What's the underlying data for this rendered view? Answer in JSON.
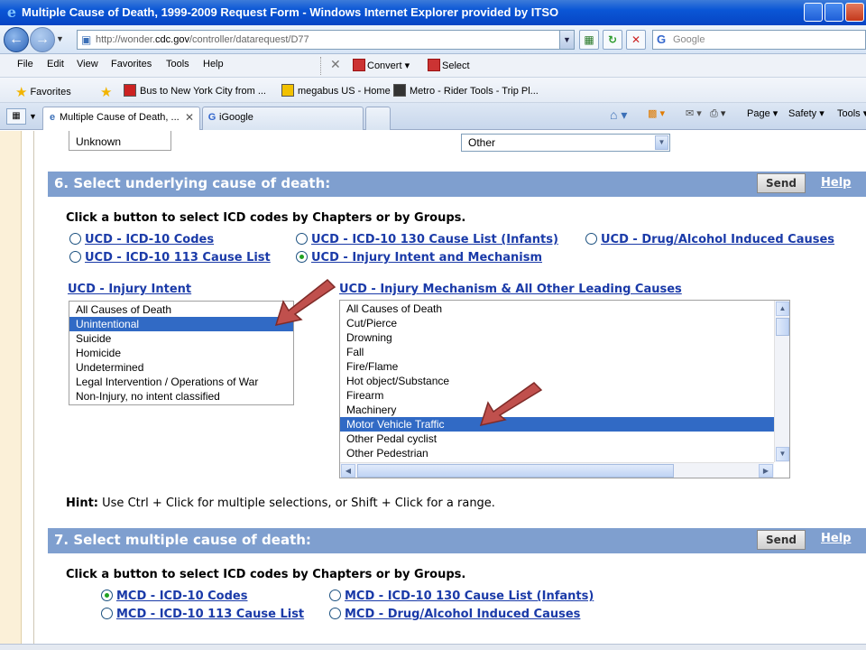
{
  "window": {
    "title": "Multiple Cause of Death, 1999-2009 Request Form - Windows Internet Explorer provided by ITSO"
  },
  "address": {
    "url_prefix": "http://wonder.",
    "url_domain": "cdc.gov",
    "url_path": "/controller/datarequest/D77",
    "search_placeholder": "Google"
  },
  "menu": {
    "items": [
      "File",
      "Edit",
      "View",
      "Favorites",
      "Tools",
      "Help"
    ],
    "convert": "Convert",
    "select": "Select"
  },
  "favorites": {
    "label": "Favorites",
    "links": [
      "Bus to New York City from ...",
      "megabus US - Home",
      "Metro - Rider Tools - Trip Pl..."
    ]
  },
  "tabs": [
    {
      "label": "Multiple Cause of Death, ...",
      "active": true
    },
    {
      "label": "iGoogle",
      "active": false
    }
  ],
  "commands": {
    "page": "Page",
    "safety": "Safety",
    "tools": "Tools"
  },
  "top_fields": {
    "left_value": "Unknown",
    "right_value": "Other"
  },
  "section6": {
    "title": "6. Select underlying cause of death:",
    "send": "Send",
    "help": "Help",
    "instruction": "Click a button to select ICD codes by Chapters or by Groups.",
    "radios": [
      {
        "label": "UCD - ICD-10 Codes",
        "checked": false
      },
      {
        "label": "UCD - ICD-10 130 Cause List (Infants)",
        "checked": false
      },
      {
        "label": "UCD - Drug/Alcohol Induced Causes",
        "checked": false
      },
      {
        "label": "UCD - ICD-10 113 Cause List",
        "checked": false
      },
      {
        "label": "UCD - Injury Intent and Mechanism",
        "checked": true
      }
    ],
    "intent_label": "UCD - Injury Intent",
    "intent_options": [
      "All Causes of Death",
      "Unintentional",
      "Suicide",
      "Homicide",
      "Undetermined",
      "Legal Intervention / Operations of War",
      "Non-Injury, no intent classified"
    ],
    "intent_selected": "Unintentional",
    "mechanism_label": "UCD - Injury Mechanism & All Other Leading Causes",
    "mechanism_options": [
      "All Causes of Death",
      "Cut/Pierce",
      "Drowning",
      "Fall",
      "Fire/Flame",
      "Hot object/Substance",
      "Firearm",
      "Machinery",
      "Motor Vehicle Traffic",
      "Other Pedal cyclist",
      "Other Pedestrian"
    ],
    "mechanism_selected": "Motor Vehicle Traffic",
    "hint_bold": "Hint:",
    "hint_text": " Use Ctrl + Click for multiple selections, or Shift + Click for a range."
  },
  "section7": {
    "title": "7. Select multiple cause of death:",
    "send": "Send",
    "help": "Help",
    "instruction": "Click a button to select ICD codes by Chapters or by Groups.",
    "radios": [
      {
        "label": "MCD - ICD-10 Codes",
        "checked": true
      },
      {
        "label": "MCD - ICD-10 130 Cause List (Infants)",
        "checked": false
      },
      {
        "label": "MCD - ICD-10 113 Cause List",
        "checked": false
      },
      {
        "label": "MCD - Drug/Alcohol Induced Causes",
        "checked": false
      }
    ]
  },
  "colors": {
    "section_header": "#7f9fcf",
    "selection": "#316ac5",
    "link": "#1a3aa8",
    "annotation_arrow": "#c0504d"
  }
}
